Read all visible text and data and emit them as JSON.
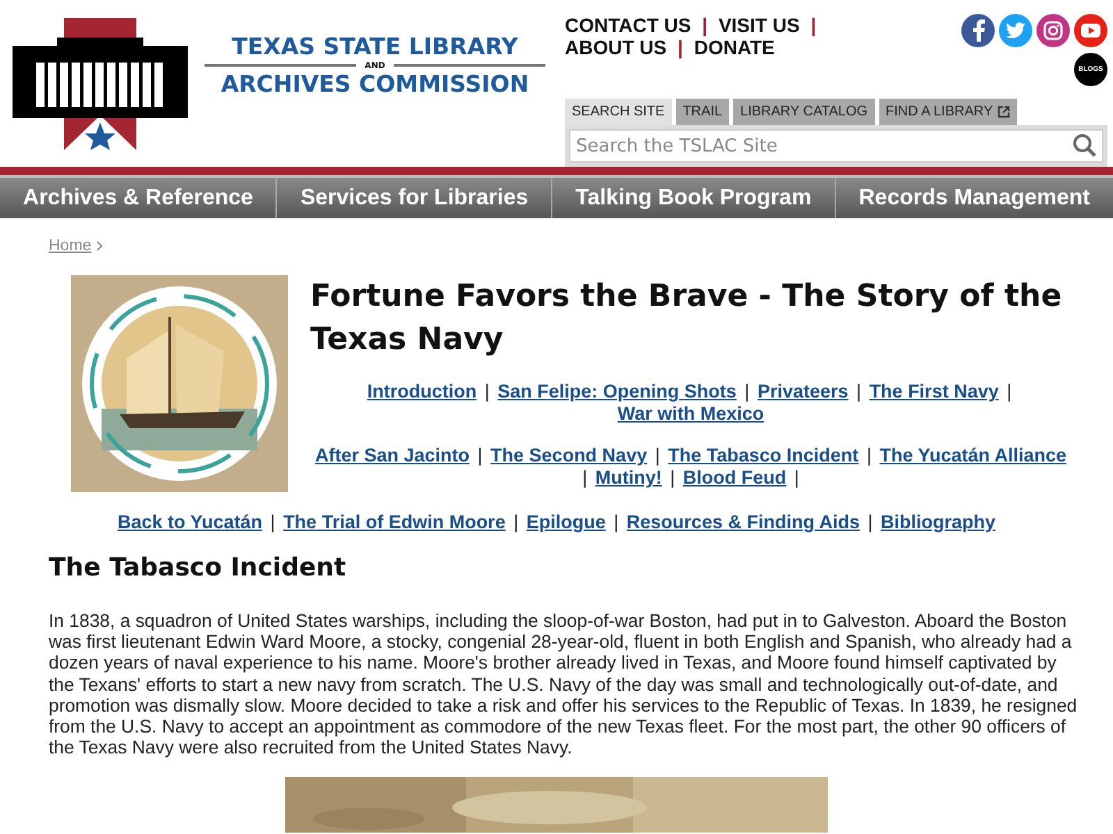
{
  "logo": {
    "line_1": "TEXAS STATE LIBRARY",
    "line_2": "AND",
    "line_3": "ARCHIVES COMMISSION"
  },
  "utility_links": [
    {
      "kind": "link",
      "text": "CONTACT US"
    },
    {
      "kind": "separator",
      "text": "|"
    },
    {
      "kind": "link",
      "text": "VISIT US"
    },
    {
      "kind": "separator",
      "text": "|"
    },
    {
      "kind": "link",
      "text": "ABOUT US"
    },
    {
      "kind": "separator",
      "text": "|"
    },
    {
      "kind": "link",
      "text": "DONATE"
    }
  ],
  "social": {
    "blogs_label": "BLOGS"
  },
  "search_tabs": [
    {
      "label": "SEARCH SITE",
      "selected": true,
      "external": false
    },
    {
      "label": "TRAIL",
      "selected": false,
      "external": false
    },
    {
      "label": "LIBRARY CATALOG",
      "selected": false,
      "external": false
    },
    {
      "label": "FIND A LIBRARY",
      "selected": false,
      "external": true
    }
  ],
  "search": {
    "placeholder": "Search the TSLAC Site"
  },
  "main_nav": [
    "Archives & Reference",
    "Services for Libraries",
    "Talking Book Program",
    "Records Management"
  ],
  "breadcrumb": [
    "Home"
  ],
  "title": "Fortune Favors the Brave - The Story of the Texas Navy",
  "chapter_groups": [
    [
      {
        "kind": "link",
        "text": "Introduction"
      },
      {
        "kind": "separator",
        "text": "|"
      },
      {
        "kind": "link",
        "text": "San Felipe: Opening Shots"
      },
      {
        "kind": "separator",
        "text": "|"
      },
      {
        "kind": "link",
        "text": "Privateers"
      },
      {
        "kind": "separator",
        "text": "|"
      },
      {
        "kind": "link",
        "text": "The First Navy"
      },
      {
        "kind": "separator",
        "text": "|"
      },
      {
        "kind": "link",
        "text": "War with Mexico"
      }
    ],
    [
      {
        "kind": "link",
        "text": "After San Jacinto"
      },
      {
        "kind": "separator",
        "text": "|"
      },
      {
        "kind": "link",
        "text": "The Second Navy"
      },
      {
        "kind": "separator",
        "text": "|"
      },
      {
        "kind": "link",
        "text": "The Tabasco Incident"
      },
      {
        "kind": "separator",
        "text": "|"
      },
      {
        "kind": "link",
        "text": "The Yucatán Alliance"
      },
      {
        "kind": "separator",
        "text": "|"
      },
      {
        "kind": "link",
        "text": "Mutiny!"
      },
      {
        "kind": "separator",
        "text": "|"
      },
      {
        "kind": "link",
        "text": "Blood Feud"
      },
      {
        "kind": "separator",
        "text": "|"
      }
    ],
    [
      {
        "kind": "link",
        "text": "Back to Yucatán"
      },
      {
        "kind": "separator",
        "text": "|"
      },
      {
        "kind": "link",
        "text": "The Trial of  Edwin Moore"
      },
      {
        "kind": "separator",
        "text": "|"
      },
      {
        "kind": "link",
        "text": "Epilogue"
      },
      {
        "kind": "separator",
        "text": "|"
      },
      {
        "kind": "link",
        "text": "Resources & Finding Aids"
      },
      {
        "kind": "separator",
        "text": "|"
      },
      {
        "kind": "link",
        "text": "Bibliography"
      }
    ]
  ],
  "section_heading": "The Tabasco Incident",
  "paragraph": "In 1838, a squadron of United States warships, including the sloop-of-war Boston, had put in to Galveston. Aboard the Boston was first lieutenant Edwin Ward Moore, a stocky, congenial 28-year-old, fluent in both English and Spanish, who already had a dozen years of naval experience to his name. Moore's brother already lived in Texas, and Moore found himself captivated by the Texans' efforts to start a new navy from scratch. The U.S. Navy of the day was small and technologically out-of-date, and promotion was dismally slow. Moore decided to take a risk and offer his services to the Republic of Texas. In 1839, he resigned from the U.S. Navy to accept an appointment as commodore of the new Texas fleet. For the most part, the other 90 officers of the Texas Navy were also recruited from the United States Navy."
}
